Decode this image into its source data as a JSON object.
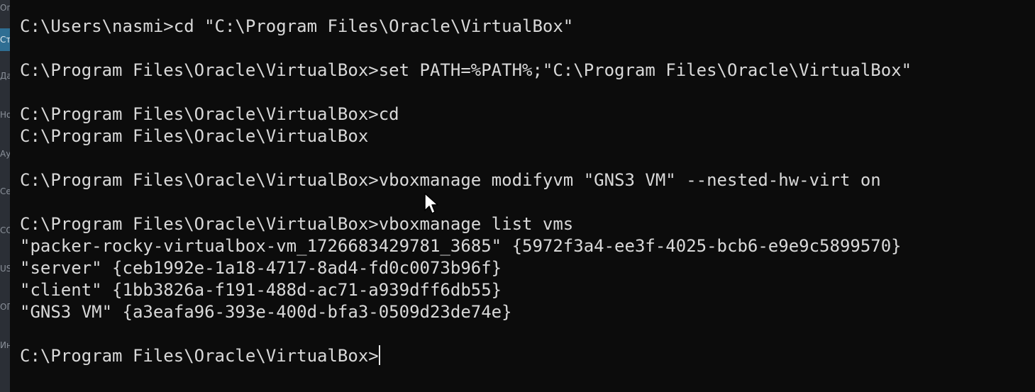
{
  "sidebar": {
    "items": [
      {
        "label": "Ог"
      },
      {
        "label": "Ст"
      },
      {
        "label": "Да"
      },
      {
        "label": "Но"
      },
      {
        "label": "Ау"
      },
      {
        "label": "Се"
      },
      {
        "label": "СО"
      },
      {
        "label": "US"
      },
      {
        "label": "ОГ"
      },
      {
        "label": "Ин"
      }
    ]
  },
  "terminal": {
    "lines": [
      "C:\\Users\\nasmi>cd \"C:\\Program Files\\Oracle\\VirtualBox\"",
      "C:\\Program Files\\Oracle\\VirtualBox>set PATH=%PATH%;\"C:\\Program Files\\Oracle\\VirtualBox\"",
      "C:\\Program Files\\Oracle\\VirtualBox>cd",
      "C:\\Program Files\\Oracle\\VirtualBox",
      "C:\\Program Files\\Oracle\\VirtualBox>vboxmanage modifyvm \"GNS3 VM\" --nested-hw-virt on",
      "C:\\Program Files\\Oracle\\VirtualBox>vboxmanage list vms",
      "\"packer-rocky-virtualbox-vm_1726683429781_3685\" {5972f3a4-ee3f-4025-bcb6-e9e9c5899570}",
      "\"server\" {ceb1992e-1a18-4717-8ad4-fd0c0073b96f}",
      "\"client\" {1bb3826a-f191-488d-ac71-a939dff6db55}",
      "\"GNS3 VM\" {a3eafa96-393e-400d-bfa3-0509d23de74e}",
      "C:\\Program Files\\Oracle\\VirtualBox>"
    ]
  }
}
